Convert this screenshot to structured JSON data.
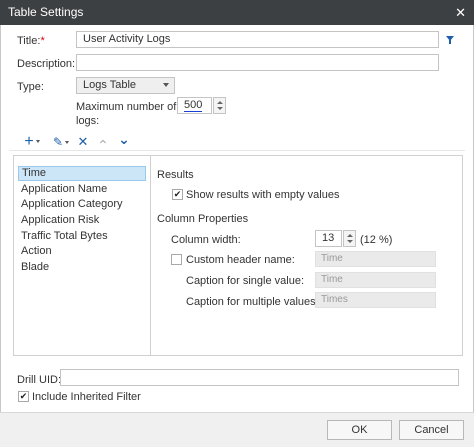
{
  "window": {
    "title": "Table Settings",
    "close_glyph": "✕"
  },
  "form": {
    "title_label": "Title:",
    "required_mark": "*",
    "title_value": "User Activity Logs",
    "filter_icon": "funnel-icon",
    "description_label": "Description:",
    "description_value": "",
    "type_label": "Type:",
    "type_value": "Logs Table",
    "max_logs_label_line1": "Maximum number of",
    "max_logs_label_line2": "logs:",
    "max_logs_value": "500"
  },
  "toolbar": {
    "add_glyph": "+",
    "edit_glyph": "✎",
    "delete_glyph": "✕",
    "up_glyph": "⌃",
    "down_glyph": "⌄"
  },
  "columns": {
    "items": [
      {
        "label": "Time",
        "selected": true
      },
      {
        "label": "Application Name",
        "selected": false
      },
      {
        "label": "Application Category",
        "selected": false
      },
      {
        "label": "Application Risk",
        "selected": false
      },
      {
        "label": "Traffic Total Bytes",
        "selected": false
      },
      {
        "label": "Action",
        "selected": false
      },
      {
        "label": "Blade",
        "selected": false
      }
    ]
  },
  "properties": {
    "results_heading": "Results",
    "show_empty_label": "Show results with empty values",
    "show_empty_checked": true,
    "column_props_heading": "Column Properties",
    "column_width_label": "Column width:",
    "column_width_value": "13",
    "column_width_percent": "(12 %)",
    "custom_header_label": "Custom header name:",
    "custom_header_checked": false,
    "custom_header_value": "Time",
    "caption_single_label": "Caption for single value:",
    "caption_single_value": "Time",
    "caption_multiple_label": "Caption for multiple values:",
    "caption_multiple_value": "Times"
  },
  "bottom": {
    "drill_uid_label": "Drill UID:",
    "drill_uid_value": "",
    "include_filter_label": "Include Inherited Filter",
    "include_filter_checked": true
  },
  "footer": {
    "ok_label": "OK",
    "cancel_label": "Cancel"
  },
  "colors": {
    "titlebar": "#3d4043",
    "accent": "#1f5fa8",
    "selection": "#cde6f7",
    "required": "#d9000d",
    "spell_underline": "#1a3fd6"
  }
}
